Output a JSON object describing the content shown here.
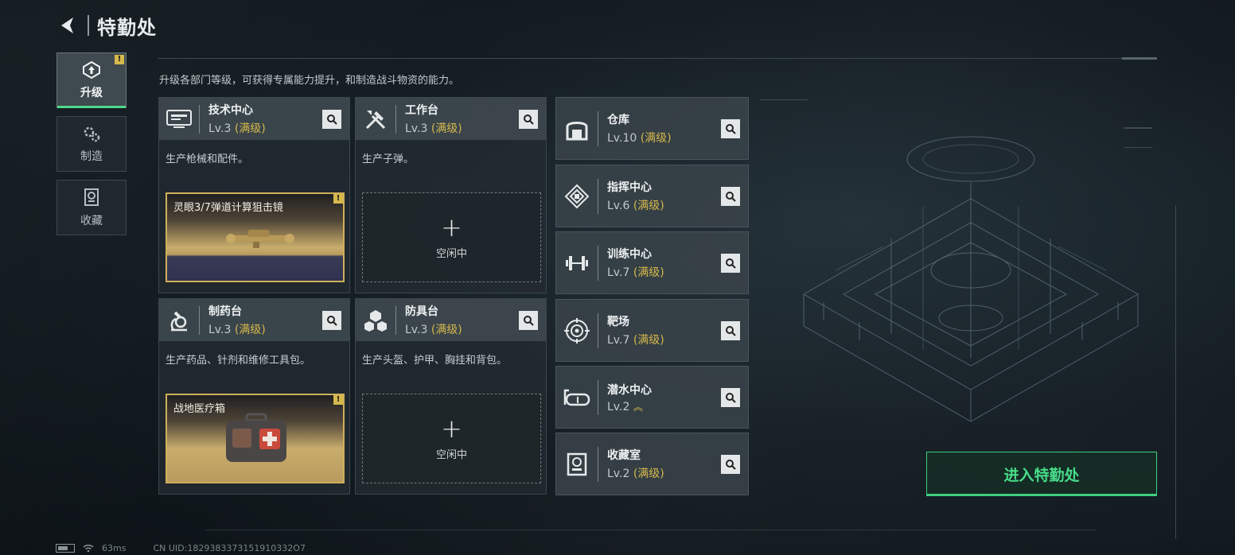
{
  "header": {
    "title": "特勤处",
    "back_icon": "back-arrow-icon"
  },
  "nav": [
    {
      "label": "升级",
      "icon": "upgrade-icon",
      "active": true,
      "badge": "!"
    },
    {
      "label": "制造",
      "icon": "gear-craft-icon",
      "active": false
    },
    {
      "label": "收藏",
      "icon": "collection-icon",
      "active": false
    }
  ],
  "subtitle": "升级各部门等级，可获得专属能力提升，和制造战斗物资的能力。",
  "departments": [
    {
      "name": "技术中心",
      "level": "Lv.3",
      "max": "(满级)",
      "desc": "生产枪械和配件。",
      "slot": {
        "state": "busy",
        "item": "灵眼3/7弹道计算狙击镜",
        "badge": "!"
      },
      "icon": "tech-monitor-icon"
    },
    {
      "name": "工作台",
      "level": "Lv.3",
      "max": "(满级)",
      "desc": "生产子弹。",
      "slot": {
        "state": "idle",
        "plus": "+",
        "label": "空闲中"
      },
      "icon": "tools-icon"
    },
    {
      "name": "制药台",
      "level": "Lv.3",
      "max": "(满级)",
      "desc": "生产药品、针剂和维修工具包。",
      "slot": {
        "state": "busy",
        "item": "战地医疗箱",
        "badge": "!"
      },
      "icon": "microscope-icon"
    },
    {
      "name": "防具台",
      "level": "Lv.3",
      "max": "(满级)",
      "desc": "生产头盔、护甲、胸挂和背包。",
      "slot": {
        "state": "idle",
        "plus": "+",
        "label": "空闲中"
      },
      "icon": "cubes-icon"
    }
  ],
  "facilities": [
    {
      "name": "仓库",
      "level": "Lv.10",
      "max": "(满级)",
      "icon": "warehouse-icon"
    },
    {
      "name": "指挥中心",
      "level": "Lv.6",
      "max": "(满级)",
      "icon": "command-diamond-icon"
    },
    {
      "name": "训练中心",
      "level": "Lv.7",
      "max": "(满级)",
      "icon": "dumbbell-icon"
    },
    {
      "name": "靶场",
      "level": "Lv.7",
      "max": "(满级)",
      "icon": "target-icon"
    },
    {
      "name": "潜水中心",
      "level": "Lv.2",
      "max": "",
      "upgrade_indicator": "︽",
      "icon": "diving-mask-icon"
    },
    {
      "name": "收藏室",
      "level": "Lv.2",
      "max": "(满级)",
      "icon": "collection-room-icon"
    }
  ],
  "enter_button": "进入特勤处",
  "status": {
    "ping": "63ms",
    "uid": "CN UID:1829383373151910332O7"
  },
  "colors": {
    "accent_green": "#47dc88",
    "max_gold": "#d6b84c",
    "panel": "#3a444a"
  }
}
